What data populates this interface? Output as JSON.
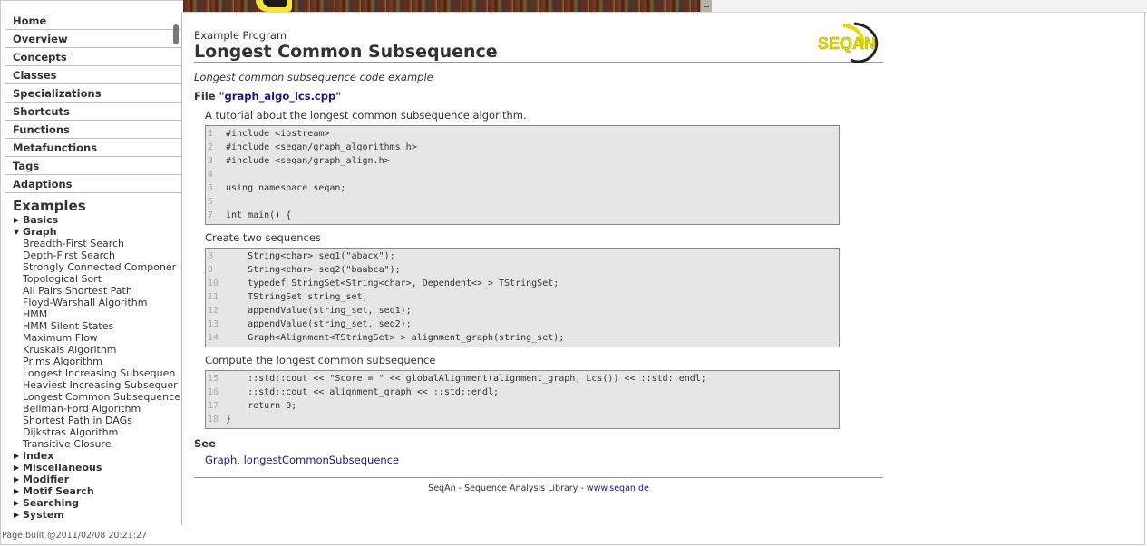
{
  "sidebar": {
    "nav": [
      "Home",
      "Overview",
      "Concepts",
      "Classes",
      "Specializations",
      "Shortcuts",
      "Functions",
      "Metafunctions",
      "Tags",
      "Adaptions"
    ],
    "examples_heading": "Examples",
    "categories_top": [
      {
        "label": "Basics",
        "expanded": false
      },
      {
        "label": "Graph",
        "expanded": true
      }
    ],
    "graph_items": [
      "Breadth-First Search",
      "Depth-First Search",
      "Strongly Connected Componer",
      "Topological Sort",
      "All Pairs Shortest Path",
      "Floyd-Warshall Algorithm",
      "HMM",
      "HMM Silent States",
      "Maximum Flow",
      "Kruskals Algorithm",
      "Prims Algorithm",
      "Longest Increasing Subsequen",
      "Heaviest Increasing Subsequer",
      "Longest Common Subsequence",
      "Bellman-Ford Algorithm",
      "Shortest Path in DAGs",
      "Dijkstras Algorithm",
      "Transitive Closure"
    ],
    "categories_bottom": [
      "Index",
      "Miscellaneous",
      "Modifier",
      "Motif Search",
      "Searching",
      "System"
    ],
    "collapsed_icon": "triangle-right-icon",
    "expanded_icon": "triangle-down-icon"
  },
  "status": {
    "page_built": "Page built @2011/02/08 20:21:27"
  },
  "main": {
    "kicker": "Example Program",
    "title": "Longest Common Subsequence",
    "logo_text": "SEQAN",
    "summary": "Longest common subsequence code example",
    "file_prefix": "File \"",
    "file_name": "graph_algo_lcs.cpp",
    "file_suffix": "\"",
    "sections": [
      {
        "text": "A tutorial about the longest common subsequence algorithm.",
        "lines": [
          [
            "1",
            "#include <iostream>"
          ],
          [
            "2",
            "#include <seqan/graph_algorithms.h>"
          ],
          [
            "3",
            "#include <seqan/graph_align.h>"
          ],
          [
            "4",
            ""
          ],
          [
            "5",
            "using namespace seqan;"
          ],
          [
            "6",
            ""
          ],
          [
            "7",
            "int main() {"
          ]
        ]
      },
      {
        "text": "Create two sequences",
        "lines": [
          [
            "8",
            "    String<char> seq1(\"abacx\");"
          ],
          [
            "9",
            "    String<char> seq2(\"baabca\");"
          ],
          [
            "10",
            "    typedef StringSet<String<char>, Dependent<> > TStringSet;"
          ],
          [
            "11",
            "    TStringSet string_set;"
          ],
          [
            "12",
            "    appendValue(string_set, seq1);"
          ],
          [
            "13",
            "    appendValue(string_set, seq2);"
          ],
          [
            "14",
            "    Graph<Alignment<TStringSet> > alignment_graph(string_set);"
          ]
        ]
      },
      {
        "text": "Compute the longest common subsequence",
        "lines": [
          [
            "15",
            "    ::std::cout << \"Score = \" << globalAlignment(alignment_graph, Lcs()) << ::std::endl;"
          ],
          [
            "16",
            "    ::std::cout << alignment_graph << ::std::endl;"
          ],
          [
            "17",
            "    return 0;"
          ],
          [
            "18",
            "}"
          ]
        ]
      }
    ],
    "see_heading": "See",
    "see_links": [
      "Graph",
      "longestCommonSubsequence"
    ],
    "see_separator": ", ",
    "footer_text": "SeqAn - Sequence Analysis Library - ",
    "footer_link": "www.seqan.de"
  },
  "colors": {
    "link": "#1a1a7a",
    "code_bg": "#e6e6e6",
    "logo_yellow": "#e8d800"
  }
}
